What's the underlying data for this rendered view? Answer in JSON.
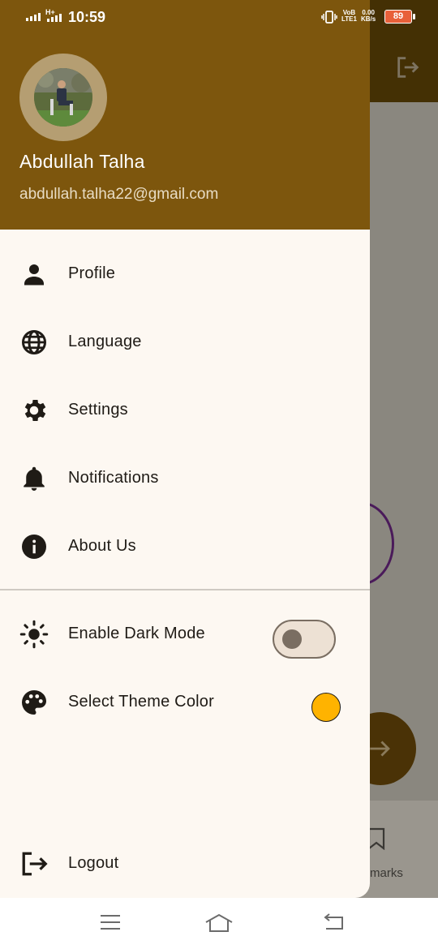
{
  "status_bar": {
    "time": "10:59",
    "network": "H+",
    "volte_line1": "VoB",
    "volte_line2": "LTE1",
    "speed_value": "0.00",
    "speed_unit": "KB/s",
    "battery": "89"
  },
  "profile": {
    "name": "Abdullah Talha",
    "email": "abdullah.talha22@gmail.com"
  },
  "menu": [
    {
      "label": "Profile",
      "icon": "person-icon"
    },
    {
      "label": "Language",
      "icon": "globe-icon"
    },
    {
      "label": "Settings",
      "icon": "gear-icon"
    },
    {
      "label": "Notifications",
      "icon": "bell-icon"
    },
    {
      "label": "About Us",
      "icon": "info-icon"
    }
  ],
  "preferences": {
    "dark_mode_label": "Enable Dark Mode",
    "dark_mode_enabled": false,
    "theme_color_label": "Select Theme Color",
    "theme_color": "#ffb300"
  },
  "logout_label": "Logout",
  "background": {
    "bottom_nav_label": "marks"
  },
  "colors": {
    "header": "#7d560d",
    "drawer_bg": "#fdf8f2",
    "accent": "#ffb300"
  }
}
